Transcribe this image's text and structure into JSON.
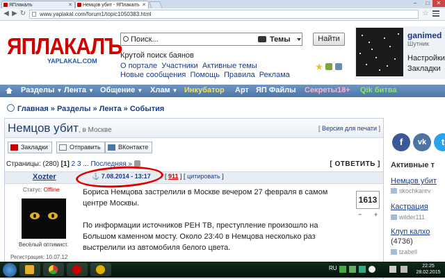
{
  "browser": {
    "tabs": [
      {
        "label": "ЯПлакалъ",
        "active": false
      },
      {
        "label": "Немцов убит - ЯПлакалъ",
        "active": true
      }
    ],
    "url": "www.yaplakal.com/forum1/topic1050383.html"
  },
  "header": {
    "logo": "ЯПЛАКАЛЪ",
    "logo_sub": "YAPLAKAL.COM",
    "search_placeholder": "Поиск...",
    "search_scope": "Темы",
    "search_button": "Найти",
    "tagline": "Крутой поиск баянов",
    "links_row1": [
      "О портале",
      "Участники",
      "Активные темы"
    ],
    "links_row2": [
      "Новые сообщения",
      "Помощь",
      "Правила",
      "Реклама"
    ]
  },
  "profile": {
    "name": "ganimed",
    "rank": "Шутник",
    "settings": "Настройки",
    "bookmarks": "Закладки"
  },
  "nav": {
    "items": [
      {
        "label": "Разделы",
        "dd": true,
        "color": "#ffffff"
      },
      {
        "label": "Лента",
        "dd": true,
        "color": "#ffffff"
      },
      {
        "label": "Общение",
        "dd": true,
        "color": "#ffffff"
      },
      {
        "label": "Хлам",
        "dd": true,
        "color": "#ffffff"
      },
      {
        "label": "Инкубатор",
        "dd": false,
        "color": "#f5e35a"
      },
      {
        "label": "Арт",
        "dd": false,
        "color": "#ffffff"
      },
      {
        "label": "ЯП Файлы",
        "dd": false,
        "color": "#ffffff"
      },
      {
        "label": "Секреты18+",
        "dd": false,
        "color": "#ffb0cc"
      },
      {
        "label": "Qik битва",
        "dd": false,
        "color": "#8fe85a"
      }
    ]
  },
  "breadcrumb": [
    "Главная",
    "Разделы",
    "Лента",
    "События"
  ],
  "topic": {
    "title": "Немцов убит",
    "location": ", в Москве",
    "print_version": "Версия для печати",
    "share": [
      "Закладки",
      "Отправить",
      "ВКонтакте"
    ],
    "pages_label": "Страницы:",
    "pages_count": "(280)",
    "pages": [
      "[1]",
      "2",
      "3",
      "...",
      "Последняя »"
    ],
    "reply": "ОТВЕТИТЬ"
  },
  "post": {
    "author": "Xozter",
    "date": "7.08.2014 - 13:17",
    "number": "911",
    "quote": "цитировать",
    "status_label": "Статус:",
    "status_value": "Offline",
    "motto": "Весёлый оптимист.",
    "reg": "Регистрация: 10.07.12",
    "paragraphs": [
      "Бориса Немцова застрелили в Москве вечером 27 февраля в самом центре Москвы.",
      "По информации источников РЕН ТВ, преступление произошло на Большом каменном мосту. Около 23:40 в Немцова несколько раз выстрелили из автомобиля белого цвета."
    ],
    "rating": "1613"
  },
  "sidebar": {
    "social": [
      {
        "label": "f",
        "color": "#3b5998"
      },
      {
        "label": "vk",
        "color": "#4c75a3"
      },
      {
        "label": "t",
        "color": "#2aa3ef"
      }
    ],
    "title": "Активные т",
    "items": [
      {
        "label": "Немцов убит",
        "meta": "skochkarev"
      },
      {
        "label": "Кастрация",
        "meta": "wilder111"
      },
      {
        "label": "Клуп калхо",
        "count": "(4736)",
        "meta": "tzabell"
      }
    ]
  },
  "taskbar": {
    "lang": "RU",
    "time": "22:25",
    "date": "28.02.2015"
  }
}
